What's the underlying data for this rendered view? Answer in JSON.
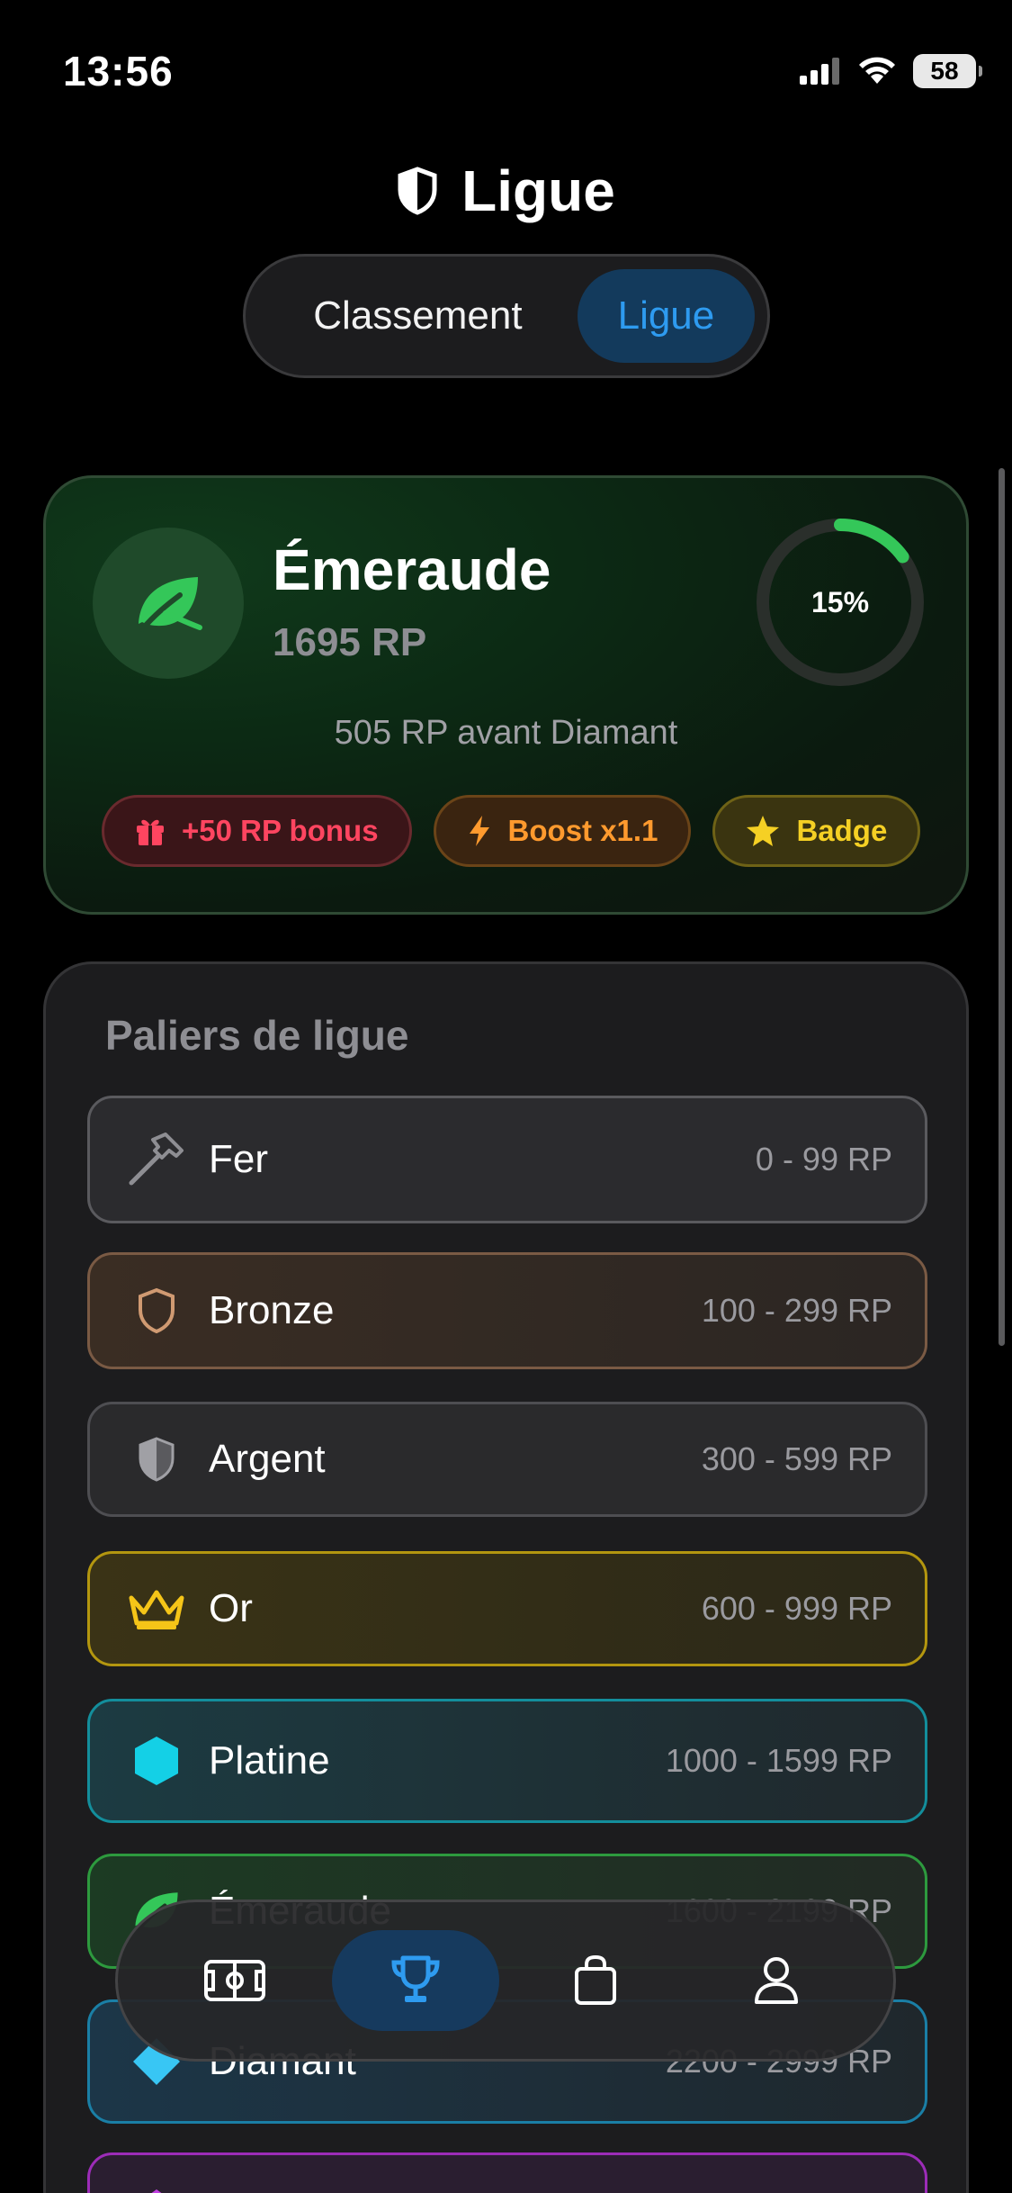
{
  "status_bar": {
    "time": "13:56",
    "battery": "58"
  },
  "header": {
    "title": "Ligue",
    "icon": "shield-icon"
  },
  "tabs": [
    {
      "label": "Classement",
      "active": false
    },
    {
      "label": "Ligue",
      "active": true
    }
  ],
  "league": {
    "name": "Émeraude",
    "rp": "1695 RP",
    "progress_label": "15%",
    "progress": 0.15,
    "next_rank": "505 RP avant Diamant",
    "perks": [
      {
        "label": "+50 RP bonus",
        "icon": "gift-icon"
      },
      {
        "label": "Boost x1.1",
        "icon": "lightning-icon"
      },
      {
        "label": "Badge",
        "icon": "star-icon"
      }
    ]
  },
  "tiers": {
    "title": "Paliers de ligue",
    "items": [
      {
        "name": "Fer",
        "range": "0 - 99 RP",
        "icon": "hammer-icon"
      },
      {
        "name": "Bronze",
        "range": "100 - 299 RP",
        "icon": "shield-outline-icon"
      },
      {
        "name": "Argent",
        "range": "300 - 599 RP",
        "icon": "shield-half-icon"
      },
      {
        "name": "Or",
        "range": "600 - 999 RP",
        "icon": "crown-icon"
      },
      {
        "name": "Platine",
        "range": "1000 - 1599 RP",
        "icon": "hexagon-icon"
      },
      {
        "name": "Émeraude",
        "range": "1600 - 2199 RP",
        "icon": "leaf-icon"
      },
      {
        "name": "Diamant",
        "range": "2200 - 2999 RP",
        "icon": "diamond-icon"
      },
      {
        "name": "",
        "range": "",
        "icon": "gem-icon"
      }
    ]
  },
  "bottom_nav": [
    {
      "name": "field-icon",
      "active": false
    },
    {
      "name": "trophy-icon",
      "active": true
    },
    {
      "name": "shopping-bag-icon",
      "active": false
    },
    {
      "name": "profile-icon",
      "active": false
    }
  ],
  "colors": {
    "accent": "#2E9BF0",
    "emerald": "#34C759",
    "bonus": "#FF4560",
    "boost": "#FF9A2E",
    "badge": "#F5D024"
  }
}
